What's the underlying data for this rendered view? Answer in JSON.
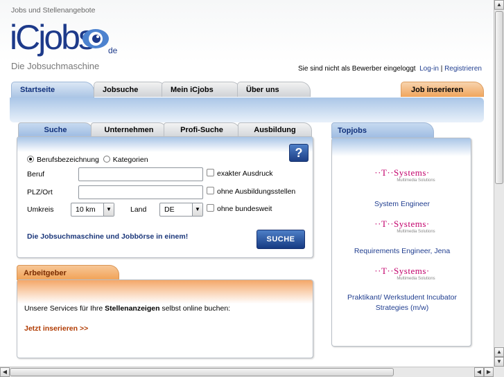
{
  "header": {
    "tagline": "Jobs und Stellenangebote",
    "logo_text": "iCjobs",
    "logo_suffix": "de",
    "slogan": "Die Jobsuchmaschine",
    "login_status": "Sie sind nicht als Bewerber eingeloggt",
    "login_link": "Log-in",
    "separator": "|",
    "register_link": "Registrieren"
  },
  "main_tabs": [
    {
      "label": "Startseite"
    },
    {
      "label": "Jobsuche"
    },
    {
      "label": "Mein iCjobs"
    },
    {
      "label": "Über uns"
    },
    {
      "label": "Job inserieren"
    }
  ],
  "search": {
    "tabs": [
      {
        "label": "Suche"
      },
      {
        "label": "Unternehmen"
      },
      {
        "label": "Profi-Suche"
      },
      {
        "label": "Ausbildung"
      }
    ],
    "help_label": "?",
    "radio_job": "Berufsbezeichnung",
    "radio_categories": "Kategorien",
    "beruf_label": "Beruf",
    "beruf_value": "",
    "exact_label": "exakter Ausdruck",
    "plz_label": "PLZ/Ort",
    "plz_value": "",
    "no_training_label": "ohne Ausbildungsstellen",
    "radius_label": "Umkreis",
    "radius_value": "10 km",
    "country_label": "Land",
    "country_value": "DE",
    "no_nationwide_label": "ohne bundesweit",
    "slogan": "Die Jobsuchmaschine und Jobbörse in einem!",
    "submit_label": "SUCHE"
  },
  "employer": {
    "title": "Arbeitgeber",
    "text_before": "Unsere Services für Ihre ",
    "text_bold": "Stellenanzeigen",
    "text_after": " selbst online buchen:",
    "link": "Jetzt inserieren >>"
  },
  "topjobs": {
    "title": "Topjobs",
    "items": [
      {
        "company": "··T··Systems·",
        "company_sub": "Multimedia Solutions",
        "job": "System Engineer"
      },
      {
        "company": "··T··Systems·",
        "company_sub": "Multimedia Solutions",
        "job": "Requirements Engineer, Jena"
      },
      {
        "company": "··T··Systems·",
        "company_sub": "Multimedia Solutions",
        "job": "Praktikant/ Werkstudent Incubator Strategies (m/w)"
      }
    ]
  },
  "colors": {
    "brand_blue": "#1d3a8a",
    "tab_blue": "#a8c3e4",
    "accent_orange": "#f1a154",
    "tsystems_magenta": "#c2006b"
  }
}
